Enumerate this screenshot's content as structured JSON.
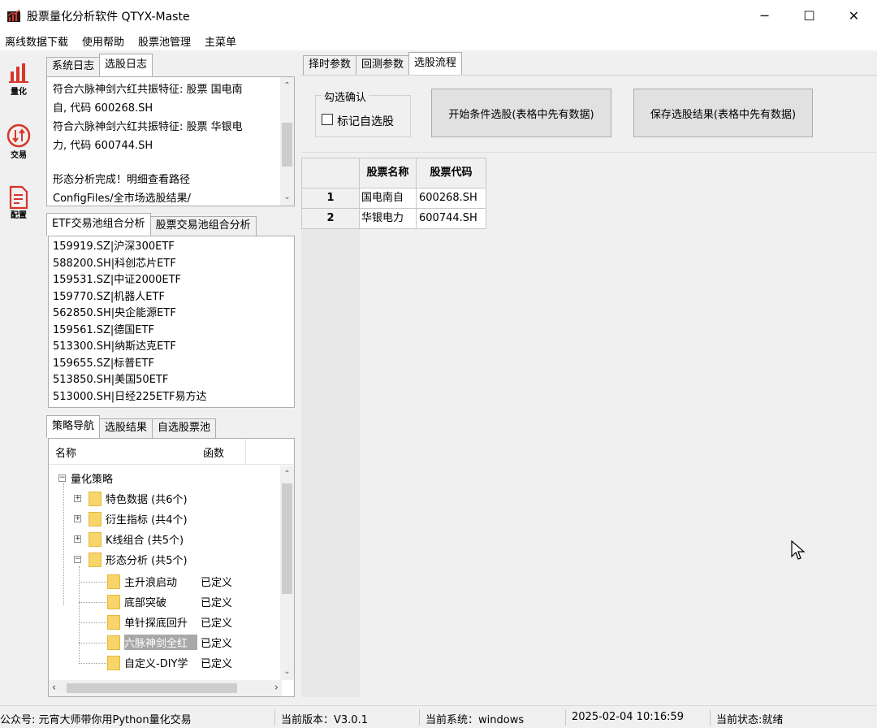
{
  "window": {
    "title": "股票量化分析软件 QTYX-Maste"
  },
  "window_controls": {
    "minimize": "─",
    "maximize": "☐",
    "close": "✕"
  },
  "menu": [
    "离线数据下载",
    "使用帮助",
    "股票池管理",
    "主菜单"
  ],
  "toolbar": [
    {
      "label": "量化",
      "icon": "bar-chart-icon",
      "color": "#d9342b"
    },
    {
      "label": "交易",
      "icon": "trade-swap-icon",
      "color": "#d9342b"
    },
    {
      "label": "配置",
      "icon": "document-icon",
      "color": "#d9342b"
    }
  ],
  "log_tabs": [
    "系统日志",
    "选股日志"
  ],
  "log_lines": [
    "符合六脉神剑六红共振特征: 股票 国电南",
    "自, 代码 600268.SH",
    "符合六脉神剑六红共振特征: 股票 华银电",
    "力, 代码 600744.SH",
    "",
    "形态分析完成！明细查看路径",
    "ConfigFiles/全市场选股结果/"
  ],
  "pool_tabs": [
    "ETF交易池组合分析",
    "股票交易池组合分析"
  ],
  "etf_list": [
    "159919.SZ|沪深300ETF",
    "588200.SH|科创芯片ETF",
    "159531.SZ|中证2000ETF",
    "159770.SZ|机器人ETF",
    "562850.SH|央企能源ETF",
    "159561.SZ|德国ETF",
    "513300.SH|纳斯达克ETF",
    "159655.SZ|标普ETF",
    "513850.SH|美国50ETF",
    "513000.SH|日经225ETF易方达"
  ],
  "nav_tabs": [
    "策略导航",
    "选股结果",
    "自选股票池"
  ],
  "tree": {
    "columns": [
      "名称",
      "函数"
    ],
    "root": "量化策略",
    "groups": [
      {
        "label": "特色数据 (共6个)",
        "expander": "+"
      },
      {
        "label": "衍生指标 (共4个)",
        "expander": "+"
      },
      {
        "label": "K线组合 (共5个)",
        "expander": "+"
      },
      {
        "label": "形态分析 (共5个)",
        "expander": "−"
      }
    ],
    "leaves": [
      {
        "name": "主升浪启动",
        "func": "已定义"
      },
      {
        "name": "底部突破",
        "func": "已定义"
      },
      {
        "name": "单针探底回升",
        "func": "已定义"
      },
      {
        "name": "六脉神剑全红",
        "func": "已定义"
      },
      {
        "name": "自定义-DIY学",
        "func": "已定义"
      }
    ]
  },
  "right_tabs": [
    "择时参数",
    "回测参数",
    "选股流程"
  ],
  "select_confirm": {
    "group_title": "勾选确认",
    "checkbox_label": "标记自选股",
    "checked": false
  },
  "buttons": {
    "start": "开始条件选股(表格中先有数据)",
    "save": "保存选股结果(表格中先有数据)"
  },
  "grid": {
    "headers": [
      "股票名称",
      "股票代码"
    ],
    "rows": [
      {
        "num": "1",
        "name": "国电南自",
        "code": "600268.SH"
      },
      {
        "num": "2",
        "name": "华银电力",
        "code": "600744.SH"
      }
    ]
  },
  "status": [
    "公众号: 元宵大师带你用Python量化交易",
    "当前版本：V3.0.1",
    "当前系统：windows",
    "2025-02-04 10:16:59",
    "当前状态:就绪"
  ]
}
